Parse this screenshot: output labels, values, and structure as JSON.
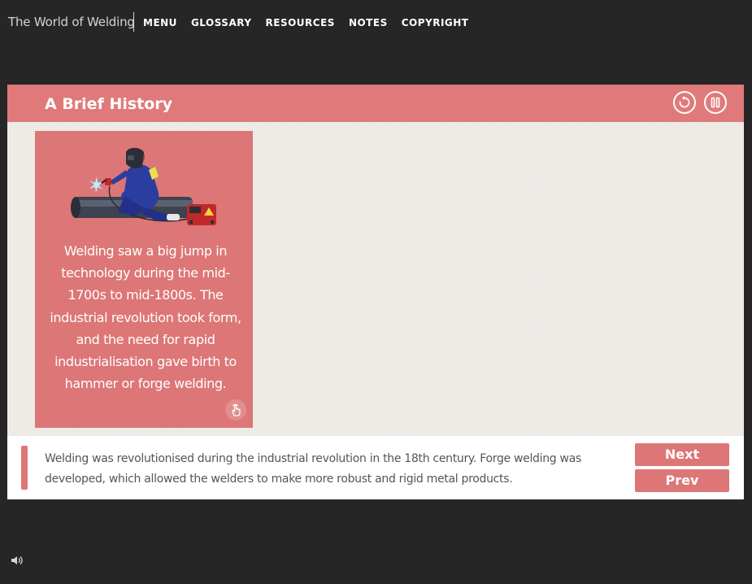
{
  "app": {
    "title": "The World of Welding"
  },
  "nav": {
    "items": [
      {
        "label": "MENU"
      },
      {
        "label": "GLOSSARY"
      },
      {
        "label": "RESOURCES"
      },
      {
        "label": "NOTES"
      },
      {
        "label": "COPYRIGHT"
      }
    ]
  },
  "slide": {
    "title": "A Brief History",
    "controls": {
      "replay_icon": "replay-icon",
      "pause_icon": "pause-icon"
    },
    "card": {
      "illustration": "welder-illustration",
      "text": "Welding saw a big jump in technology during the mid-1700s to mid-1800s. The industrial revolution took form, and the need for rapid industrialisation gave birth to hammer or forge welding.",
      "hint_icon": "tap-hand-icon"
    },
    "narration": {
      "text": "Welding was revolutionised during the industrial revolution in the 18th century. Forge welding was developed, which allowed the welders to make more robust and rigid metal products."
    },
    "buttons": {
      "next": "Next",
      "prev": "Prev"
    }
  },
  "audio": {
    "icon": "speaker-icon"
  },
  "colors": {
    "accent": "#dd7676",
    "header": "#e07a7a",
    "background": "#262626",
    "slide_bg": "#efebe7"
  }
}
